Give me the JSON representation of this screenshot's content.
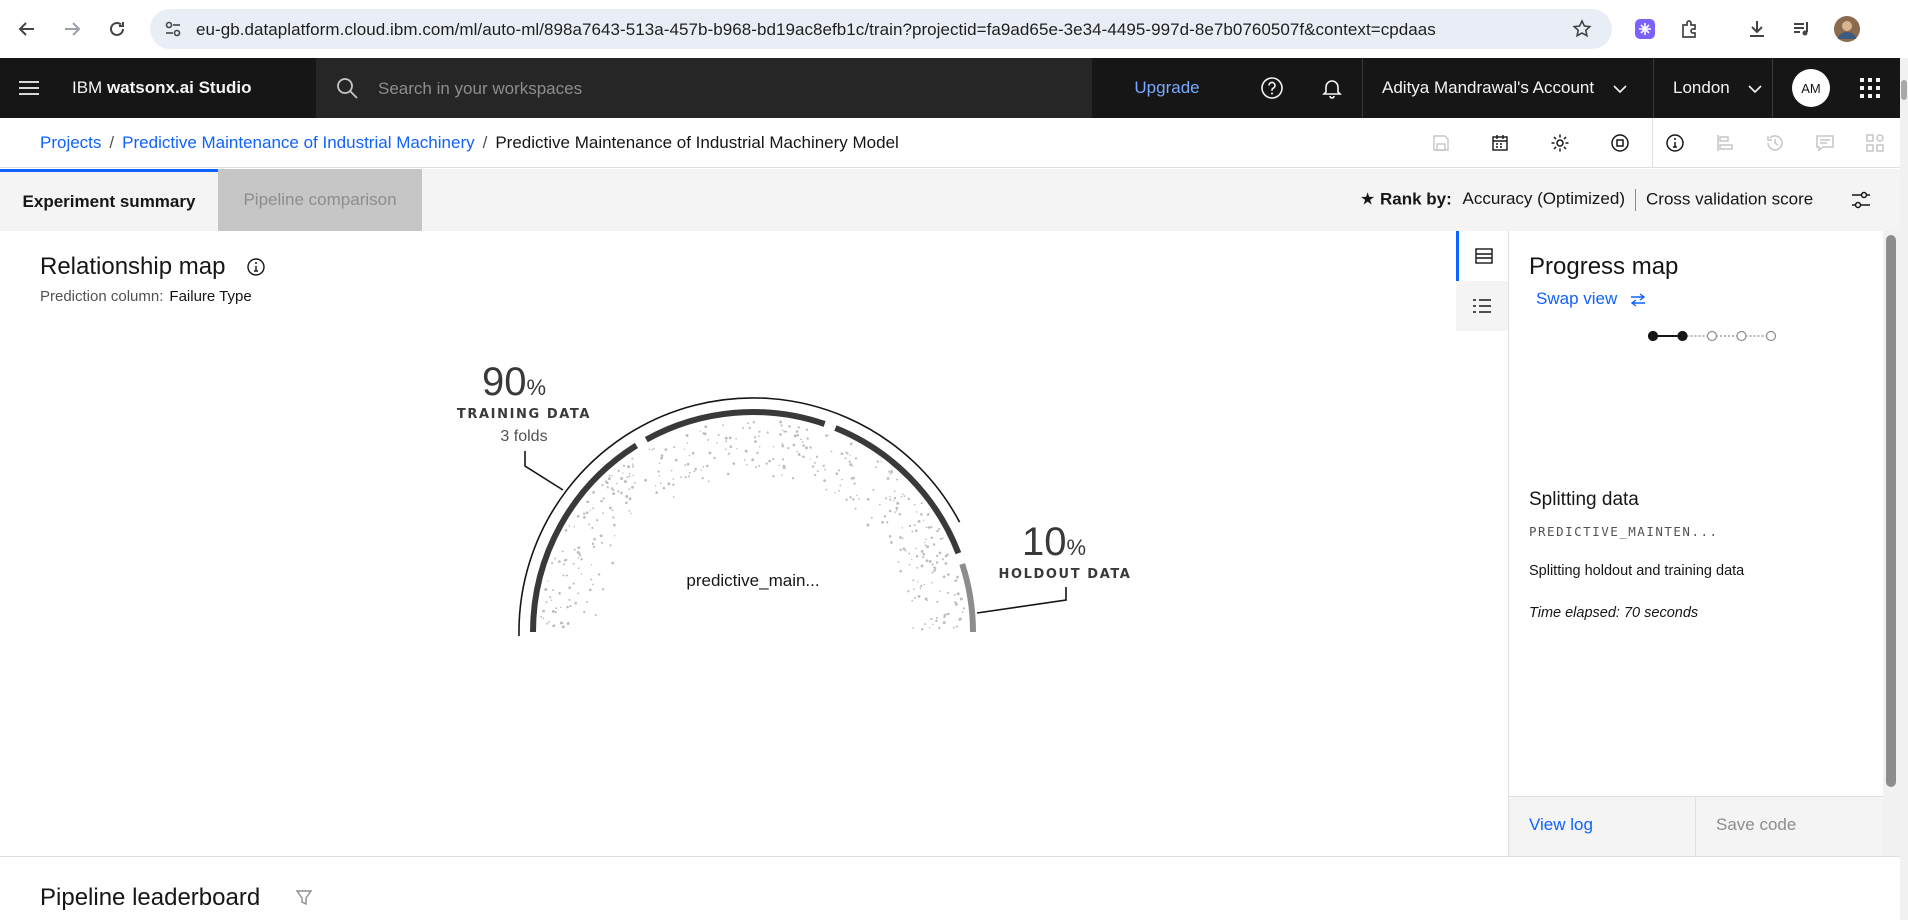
{
  "browser": {
    "url": "eu-gb.dataplatform.cloud.ibm.com/ml/auto-ml/898a7643-513a-457b-b968-bd19ac8efb1c/train?projectid=fa9ad65e-3e34-4495-997d-8e7b0760507f&context=cpdaas"
  },
  "topbar": {
    "brand_prefix": "IBM ",
    "brand_name": "watsonx.ai Studio",
    "search_placeholder": "Search in your workspaces",
    "upgrade": "Upgrade",
    "account": "Aditya Mandrawal's Account",
    "region": "London",
    "avatar": "AM"
  },
  "breadcrumb": {
    "items": [
      "Projects",
      "Predictive Maintenance of Industrial Machinery"
    ],
    "current": "Predictive Maintenance of Industrial Machinery Model",
    "separator": "/"
  },
  "tabs": {
    "summary": "Experiment summary",
    "compare": "Pipeline comparison",
    "rank_label": "Rank by:",
    "rank_metric": "Accuracy (Optimized)",
    "rank_score": "Cross validation score"
  },
  "relationship_map": {
    "title": "Relationship map",
    "prediction_label": "Prediction column:",
    "prediction_value": "Failure Type",
    "training_pct": "90",
    "training_label": "TRAINING DATA",
    "training_folds": "3 folds",
    "holdout_pct": "10",
    "holdout_label": "HOLDOUT DATA",
    "percent_sign": "%",
    "center_label": "predictive_main...",
    "training_fraction": 0.9,
    "holdout_fraction": 0.1
  },
  "progress_map": {
    "title": "Progress map",
    "swap": "Swap view",
    "step_title": "Splitting data",
    "dataset": "PREDICTIVE_MAINTEN...",
    "description": "Splitting holdout and training data",
    "elapsed": "Time elapsed: 70 seconds",
    "steps_total": 5,
    "steps_done": 2,
    "view_log": "View log",
    "save_code": "Save code"
  },
  "leaderboard": {
    "title": "Pipeline leaderboard"
  },
  "colors": {
    "accent": "#0f62fe",
    "topbar_bg": "#161616",
    "link": "#78a9ff"
  }
}
